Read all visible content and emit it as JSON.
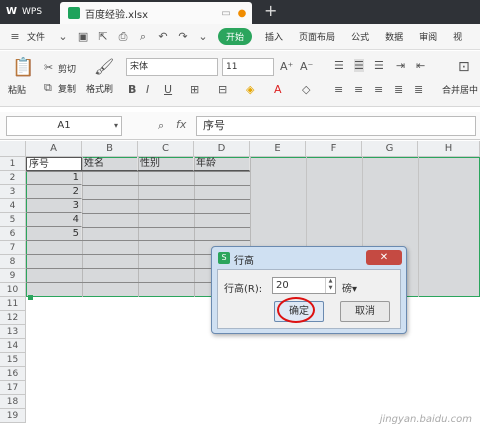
{
  "titlebar": {
    "app": "WPS",
    "file": "百度经验.xlsx"
  },
  "menubar": {
    "file_label": "文件",
    "tabs": [
      "开始",
      "插入",
      "页面布局",
      "公式",
      "数据",
      "审阅",
      "视"
    ]
  },
  "ribbon": {
    "paste": "粘贴",
    "cut": "剪切",
    "copy": "复制",
    "format_painter": "格式刷",
    "font_name": "宋体",
    "font_size": "11",
    "merge": "合并居中"
  },
  "formula_bar": {
    "cell_ref": "A1",
    "fx": "fx",
    "content": "序号"
  },
  "sheet": {
    "columns": [
      "A",
      "B",
      "C",
      "D",
      "E",
      "F",
      "G",
      "H"
    ],
    "rows": [
      "1",
      "2",
      "3",
      "4",
      "5",
      "6",
      "7",
      "8",
      "9",
      "10",
      "11",
      "12",
      "13",
      "14",
      "15",
      "16",
      "17",
      "18",
      "19"
    ],
    "headers": [
      "序号",
      "姓名",
      "性别",
      "年龄"
    ],
    "numbers": [
      "1",
      "2",
      "3",
      "4",
      "5"
    ]
  },
  "dialog": {
    "title": "行高",
    "label": "行高(R):",
    "value": "20",
    "unit": "磅▾",
    "ok": "确定",
    "cancel": "取消"
  },
  "watermark": "jingyan.baidu.com"
}
